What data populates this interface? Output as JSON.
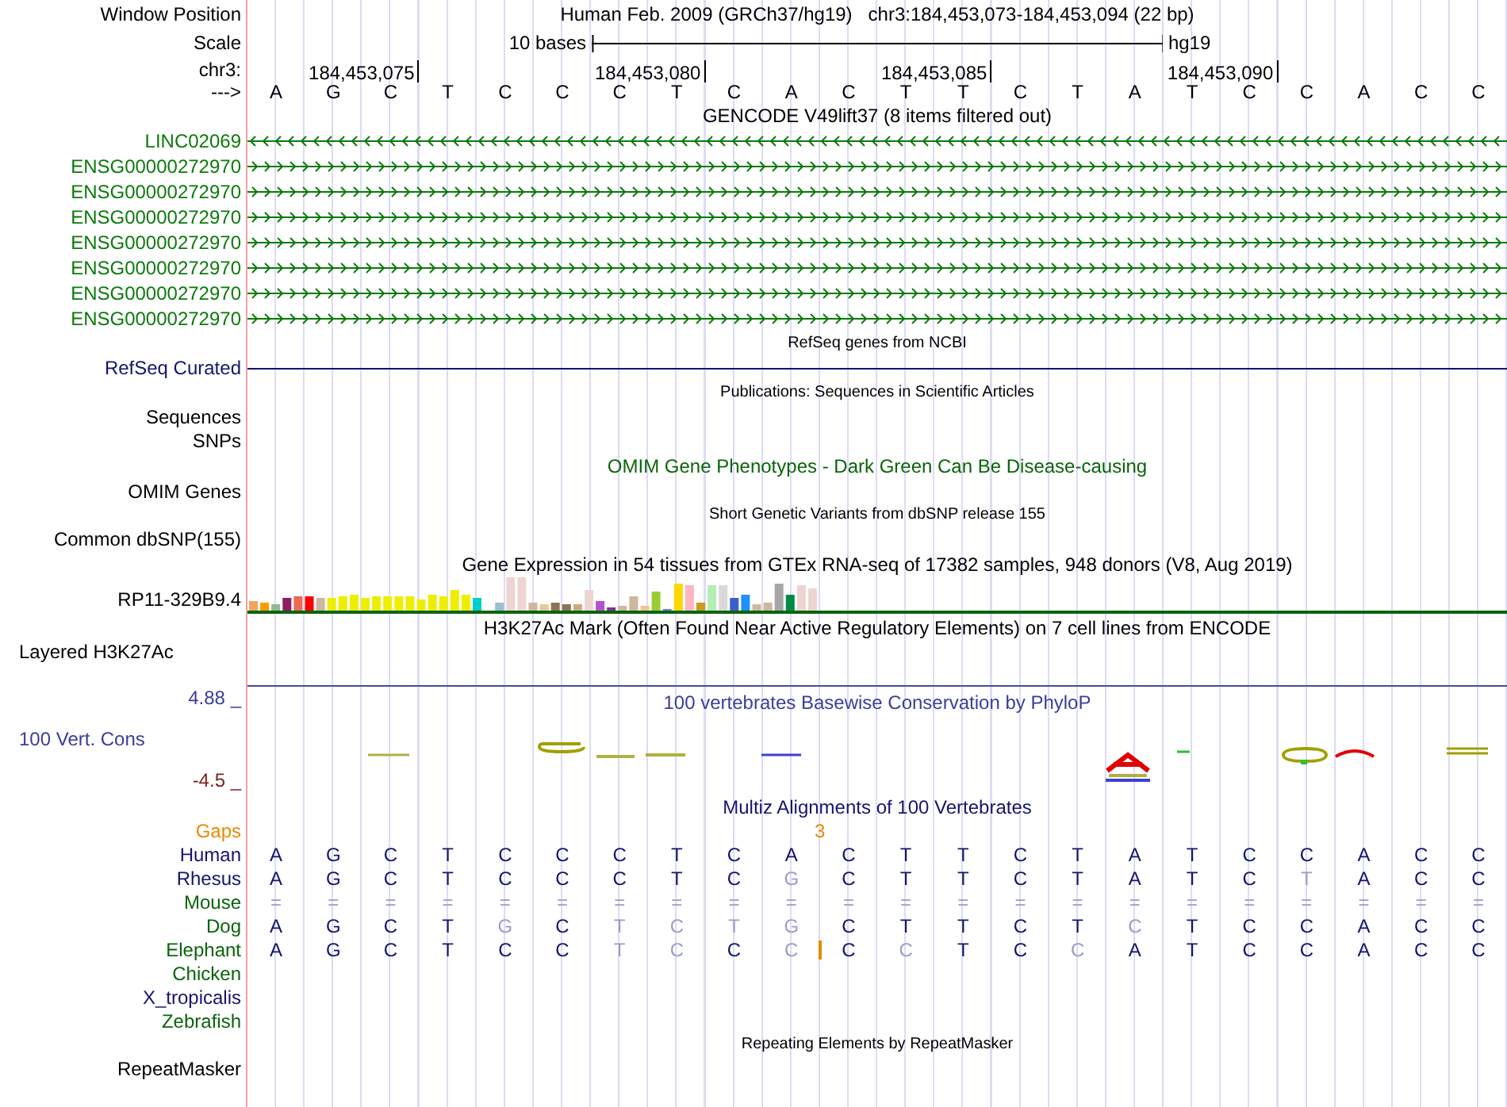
{
  "window_position": {
    "label": "Window Position",
    "assembly": "Human Feb. 2009 (GRCh37/hg19)",
    "position": "chr3:184,453,073-184,453,094 (22 bp)"
  },
  "scale": {
    "label": "Scale",
    "length": "10 bases",
    "genome": "hg19"
  },
  "ruler": {
    "label": "chr3:",
    "positions": [
      "184,453,075",
      "184,453,080",
      "184,453,085",
      "184,453,090"
    ]
  },
  "bases": {
    "label": "--->",
    "letters": [
      "A",
      "G",
      "C",
      "T",
      "C",
      "C",
      "C",
      "T",
      "C",
      "A",
      "C",
      "T",
      "T",
      "C",
      "T",
      "A",
      "T",
      "C",
      "C",
      "A",
      "C",
      "C"
    ]
  },
  "tracks": [
    {
      "kind": "title",
      "text": "GENCODE V49lift37 (8 items filtered out)",
      "color": "#000000"
    },
    {
      "kind": "gene",
      "label": "LINC02069",
      "reverse": true
    },
    {
      "kind": "gene",
      "label": "ENSG00000272970",
      "reverse": false
    },
    {
      "kind": "gene",
      "label": "ENSG00000272970",
      "reverse": false
    },
    {
      "kind": "gene",
      "label": "ENSG00000272970",
      "reverse": false
    },
    {
      "kind": "gene",
      "label": "ENSG00000272970",
      "reverse": false
    },
    {
      "kind": "gene",
      "label": "ENSG00000272970",
      "reverse": false
    },
    {
      "kind": "gene",
      "label": "ENSG00000272970",
      "reverse": false
    },
    {
      "kind": "gene",
      "label": "ENSG00000272970",
      "reverse": false
    },
    {
      "kind": "note",
      "text": "RefSeq genes from NCBI"
    },
    {
      "kind": "line",
      "label": "RefSeq Curated"
    },
    {
      "kind": "note",
      "text": "Publications: Sequences in Scientific Articles"
    },
    {
      "kind": "label",
      "label": "Sequences"
    },
    {
      "kind": "label",
      "label": "SNPs"
    },
    {
      "kind": "title",
      "text": "OMIM Gene Phenotypes - Dark Green Can Be Disease-causing",
      "color": "#0a640a"
    },
    {
      "kind": "label",
      "label": "OMIM Genes"
    },
    {
      "kind": "note",
      "text": "Short Genetic Variants from dbSNP release 155"
    },
    {
      "kind": "label",
      "label": "Common dbSNP(155)"
    },
    {
      "kind": "title",
      "text": "Gene Expression in 54 tissues from GTEx RNA-seq of 17382 samples, 948 donors (V8, Aug 2019)",
      "color": "#000000"
    },
    {
      "kind": "expression",
      "label": "RP11-329B9.4"
    },
    {
      "kind": "title",
      "text": "H3K27Ac Mark (Often Found Near Active Regulatory Elements) on 7 cell lines from ENCODE",
      "color": "#000000"
    },
    {
      "kind": "signal",
      "label": "Layered H3K27Ac"
    },
    {
      "kind": "conservation",
      "title": "100 vertebrates Basewise Conservation by PhyloP",
      "label": "100 Vert. Cons",
      "max": "4.88 _",
      "min": "-4.5 _"
    },
    {
      "kind": "title",
      "text": "Multiz Alignments of 100 Vertebrates",
      "color": "#14146e"
    },
    {
      "kind": "gaps",
      "label": "Gaps",
      "count": "3"
    },
    {
      "kind": "species",
      "label": "Human",
      "color": "#14146e",
      "insertion": false,
      "bases": [
        "A",
        "G",
        "C",
        "T",
        "C",
        "C",
        "C",
        "T",
        "C",
        "A",
        "C",
        "T",
        "T",
        "C",
        "T",
        "A",
        "T",
        "C",
        "C",
        "A",
        "C",
        "C"
      ],
      "dimmed": [
        false,
        false,
        false,
        false,
        false,
        false,
        false,
        false,
        false,
        false,
        false,
        false,
        false,
        false,
        false,
        false,
        false,
        false,
        false,
        false,
        false,
        false
      ]
    },
    {
      "kind": "species",
      "label": "Rhesus",
      "color": "#14146e",
      "insertion": false,
      "bases": [
        "A",
        "G",
        "C",
        "T",
        "C",
        "C",
        "C",
        "T",
        "C",
        "G",
        "C",
        "T",
        "T",
        "C",
        "T",
        "A",
        "T",
        "C",
        "T",
        "A",
        "C",
        "C"
      ],
      "dimmed": [
        false,
        false,
        false,
        false,
        false,
        false,
        false,
        false,
        false,
        true,
        false,
        false,
        false,
        false,
        false,
        false,
        false,
        false,
        true,
        false,
        false,
        false
      ]
    },
    {
      "kind": "species",
      "label": "Mouse",
      "color": "#0a640a",
      "insertion": false,
      "bases": [
        "=",
        "=",
        "=",
        "=",
        "=",
        "=",
        "=",
        "=",
        "=",
        "=",
        "=",
        "=",
        "=",
        "=",
        "=",
        "=",
        "=",
        "=",
        "=",
        "=",
        "=",
        "="
      ],
      "dimmed": [
        true,
        true,
        true,
        true,
        true,
        true,
        true,
        true,
        true,
        true,
        true,
        true,
        true,
        true,
        true,
        true,
        true,
        true,
        true,
        true,
        true,
        true
      ]
    },
    {
      "kind": "species",
      "label": "Dog",
      "color": "#0a640a",
      "insertion": false,
      "bases": [
        "A",
        "G",
        "C",
        "T",
        "G",
        "C",
        "T",
        "C",
        "T",
        "G",
        "C",
        "T",
        "T",
        "C",
        "T",
        "C",
        "T",
        "C",
        "C",
        "A",
        "C",
        "C"
      ],
      "dimmed": [
        false,
        false,
        false,
        false,
        true,
        false,
        true,
        true,
        true,
        true,
        false,
        false,
        false,
        false,
        false,
        true,
        false,
        false,
        false,
        false,
        false,
        false
      ]
    },
    {
      "kind": "species",
      "label": "Elephant",
      "color": "#0a640a",
      "insertion": true,
      "bases": [
        "A",
        "G",
        "C",
        "T",
        "C",
        "C",
        "T",
        "C",
        "C",
        "C",
        "C",
        "C",
        "T",
        "C",
        "C",
        "A",
        "T",
        "C",
        "C",
        "A",
        "C",
        "C"
      ],
      "dimmed": [
        false,
        false,
        false,
        false,
        false,
        false,
        true,
        true,
        false,
        true,
        false,
        true,
        false,
        false,
        true,
        false,
        false,
        false,
        false,
        false,
        false,
        false
      ]
    },
    {
      "kind": "species",
      "label": "Chicken",
      "color": "#0a640a",
      "insertion": false
    },
    {
      "kind": "species",
      "label": "X_tropicalis",
      "color": "#14146e",
      "insertion": false
    },
    {
      "kind": "species",
      "label": "Zebrafish",
      "color": "#0a640a",
      "insertion": false
    },
    {
      "kind": "note",
      "text": "Repeating Elements by RepeatMasker"
    },
    {
      "kind": "label",
      "label": "RepeatMasker"
    }
  ]
}
